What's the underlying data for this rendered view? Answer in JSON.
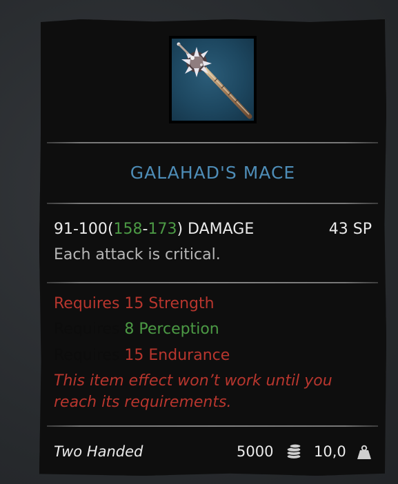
{
  "item": {
    "name": "GALAHAD'S MACE",
    "damage": {
      "base_range": "91-100",
      "open_paren": "(",
      "mod_min": "158",
      "dash": "-",
      "mod_max": "173",
      "close_suffix": ") DAMAGE"
    },
    "sp_cost": "43 SP",
    "effect": "Each attack is critical.",
    "requirements": [
      {
        "prefix": "Requires",
        "value": "15 Strength",
        "met": false
      },
      {
        "prefix": "Requires",
        "value": "8 Perception",
        "met": true
      },
      {
        "prefix": "Requires",
        "value": "15 Endurance",
        "met": false
      }
    ],
    "warning_line1": "This item effect won’t work until you",
    "warning_line2": "reach its requirements.",
    "handedness": "Two Handed",
    "value": "5000",
    "weight": "10,0"
  },
  "icons": {
    "item_icon": "mace-icon",
    "coin": "coins-icon",
    "weight": "weight-icon"
  },
  "colors": {
    "title": "#4e8db7",
    "met": "#4c9a45",
    "unmet": "#b8362e",
    "text": "#ebebeb",
    "muted": "#b7b7b7"
  }
}
